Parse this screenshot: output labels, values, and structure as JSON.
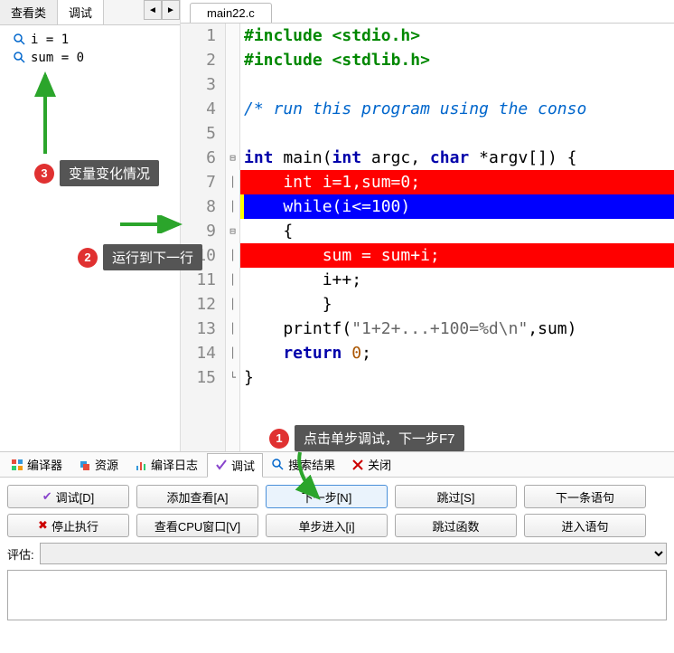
{
  "left_tabs": {
    "view_class": "查看类",
    "debug": "调试"
  },
  "watch": {
    "items": [
      {
        "text": "i = 1"
      },
      {
        "text": "sum = 0"
      }
    ]
  },
  "file_tab": "main22.c",
  "gutter": [
    "1",
    "2",
    "3",
    "4",
    "5",
    "6",
    "7",
    "8",
    "9",
    "10",
    "11",
    "12",
    "13",
    "14",
    "15"
  ],
  "code": {
    "l1_include": "#include ",
    "l1_hdr": "<stdio.h>",
    "l2_include": "#include ",
    "l2_hdr": "<stdlib.h>",
    "l4_comment": "/* run this program using the conso",
    "l6_a": "int",
    "l6_b": " main(",
    "l6_c": "int",
    "l6_d": " argc, ",
    "l6_e": "char",
    "l6_f": " *argv[]) {",
    "l7": "    int i=1,sum=0;",
    "l8": "    while(i<=100)",
    "l9": "    {",
    "l10": "        sum = sum+i;",
    "l11": "        i++;",
    "l12": "        }",
    "l13_a": "    printf(",
    "l13_b": "\"1+2+...+100=%d\\n\"",
    "l13_c": ",sum)",
    "l14_a": "    return ",
    "l14_b": "0",
    "l14_c": ";",
    "l15": "}"
  },
  "bottom_tabs": {
    "compiler": "编译器",
    "resource": "资源",
    "compile_log": "编译日志",
    "debug": "调试",
    "search_result": "搜索结果",
    "close": "关闭"
  },
  "debug_buttons": {
    "debug_d": "调试[D]",
    "add_watch": "添加查看[A]",
    "next_step": "下一步[N]",
    "skip": "跳过[S]",
    "next_stmt": "下一条语句",
    "stop": "停止执行",
    "cpu_window": "查看CPU窗口[V]",
    "step_into": "单步进入[i]",
    "skip_func": "跳过函数",
    "into_stmt": "进入语句"
  },
  "eval_label": "评估:",
  "annotations": {
    "a1": "点击单步调试，下一步F7",
    "a2": "运行到下一行",
    "a3": "变量变化情况"
  }
}
